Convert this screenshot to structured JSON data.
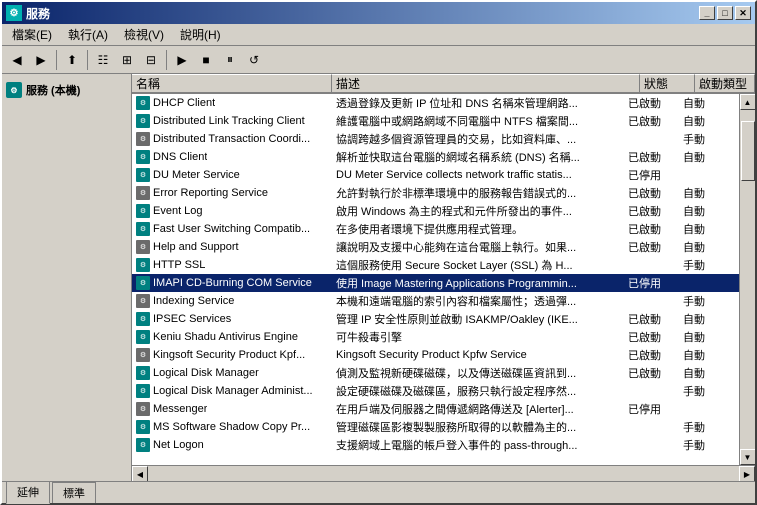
{
  "window": {
    "title": "服務",
    "icon": "⚙"
  },
  "titleButtons": {
    "minimize": "_",
    "maximize": "□",
    "close": "✕"
  },
  "menuBar": {
    "items": [
      {
        "label": "檔案(E)"
      },
      {
        "label": "執行(A)"
      },
      {
        "label": "檢視(V)"
      },
      {
        "label": "說明(H)"
      }
    ]
  },
  "toolbar": {
    "buttons": [
      {
        "icon": "←",
        "name": "back-button",
        "disabled": false
      },
      {
        "icon": "→",
        "name": "forward-button",
        "disabled": false
      },
      {
        "icon": "⬆",
        "name": "up-button",
        "disabled": false
      },
      {
        "icon": "☷",
        "name": "show-button",
        "disabled": false
      },
      {
        "icon": "⊞",
        "name": "grid-button",
        "disabled": false
      },
      {
        "icon": "⊟",
        "name": "minus-button",
        "disabled": false
      },
      {
        "icon": "▶",
        "name": "play-button",
        "disabled": false
      },
      {
        "icon": "■",
        "name": "stop-button",
        "disabled": false
      },
      {
        "icon": "⏸",
        "name": "pause-button",
        "disabled": false
      },
      {
        "icon": "↺",
        "name": "restart-button",
        "disabled": false
      }
    ]
  },
  "leftPanel": {
    "title": "服務 (本機)"
  },
  "columns": {
    "name": "名稱",
    "description": "描述",
    "status": "狀態",
    "startupType": "啟動類型"
  },
  "services": [
    {
      "name": "DHCP Client",
      "description": "透過登錄及更新 IP 位址和 DNS 名稱來管理網路...",
      "status": "已啟動",
      "startup": "自動"
    },
    {
      "name": "Distributed Link Tracking Client",
      "description": "維護電腦中或網路網域不同電腦中 NTFS 檔案間...",
      "status": "已啟動",
      "startup": "自動"
    },
    {
      "name": "Distributed Transaction Coordi...",
      "description": "協調跨越多個資源管理員的交易，比如資料庫、...",
      "status": "",
      "startup": "手動"
    },
    {
      "name": "DNS Client",
      "description": "解析並快取這台電腦的網域名稱系統 (DNS) 名稱...",
      "status": "已啟動",
      "startup": "自動"
    },
    {
      "name": "DU Meter Service",
      "description": "DU Meter Service collects network traffic statis...",
      "status": "已停用",
      "startup": ""
    },
    {
      "name": "Error Reporting Service",
      "description": "允許對執行於非標準環境中的服務報告錯誤式的...",
      "status": "已啟動",
      "startup": "自動"
    },
    {
      "name": "Event Log",
      "description": "啟用 Windows 為主的程式和元件所發出的事件...",
      "status": "已啟動",
      "startup": "自動"
    },
    {
      "name": "Fast User Switching Compatib...",
      "description": "在多使用者環境下提供應用程式管理。",
      "status": "已啟動",
      "startup": "自動"
    },
    {
      "name": "Help and Support",
      "description": "讓說明及支援中心能夠在這台電腦上執行。如果...",
      "status": "已啟動",
      "startup": "自動"
    },
    {
      "name": "HTTP SSL",
      "description": "這個服務使用 Secure Socket Layer (SSL) 為 H...",
      "status": "",
      "startup": "手動"
    },
    {
      "name": "IMAPI CD-Burning COM Service",
      "description": "使用 Image Mastering Applications Programmin...",
      "status": "已停用",
      "startup": "",
      "selected": true
    },
    {
      "name": "Indexing Service",
      "description": "本機和遠端電腦的索引內容和檔案屬性；透過彈...",
      "status": "",
      "startup": "手動"
    },
    {
      "name": "IPSEC Services",
      "description": "管理 IP 安全性原則並啟動 ISAKMP/Oakley (IKE...",
      "status": "已啟動",
      "startup": "自動"
    },
    {
      "name": "Keniu Shadu Antivirus Engine",
      "description": "可牛殺毒引擎",
      "status": "已啟動",
      "startup": "自動"
    },
    {
      "name": "Kingsoft Security Product Kpf...",
      "description": "Kingsoft Security Product Kpfw Service",
      "status": "已啟動",
      "startup": "自動"
    },
    {
      "name": "Logical Disk Manager",
      "description": "偵測及監視新硬碟磁碟，以及傳送磁碟區資訊到...",
      "status": "已啟動",
      "startup": "自動"
    },
    {
      "name": "Logical Disk Manager Administ...",
      "description": "設定硬碟磁碟及磁碟區，服務只執行設定程序然...",
      "status": "",
      "startup": "手動"
    },
    {
      "name": "Messenger",
      "description": "在用戶端及伺服器之間傳遞網路傳送及 [Alerter]...",
      "status": "已停用",
      "startup": ""
    },
    {
      "name": "MS Software Shadow Copy Pr...",
      "description": "管理磁碟區影複製製服務所取得的以軟體為主的...",
      "status": "",
      "startup": "手動"
    },
    {
      "name": "Net Logon",
      "description": "支援網域上電腦的帳戶登入事件的 pass-through...",
      "status": "",
      "startup": "手動"
    }
  ],
  "statusBar": {
    "panels": [
      {
        "label": "延伸"
      },
      {
        "label": "標準"
      }
    ]
  },
  "tabs": {
    "items": [
      {
        "label": "延伸",
        "active": true
      },
      {
        "label": "標準",
        "active": false
      }
    ]
  }
}
